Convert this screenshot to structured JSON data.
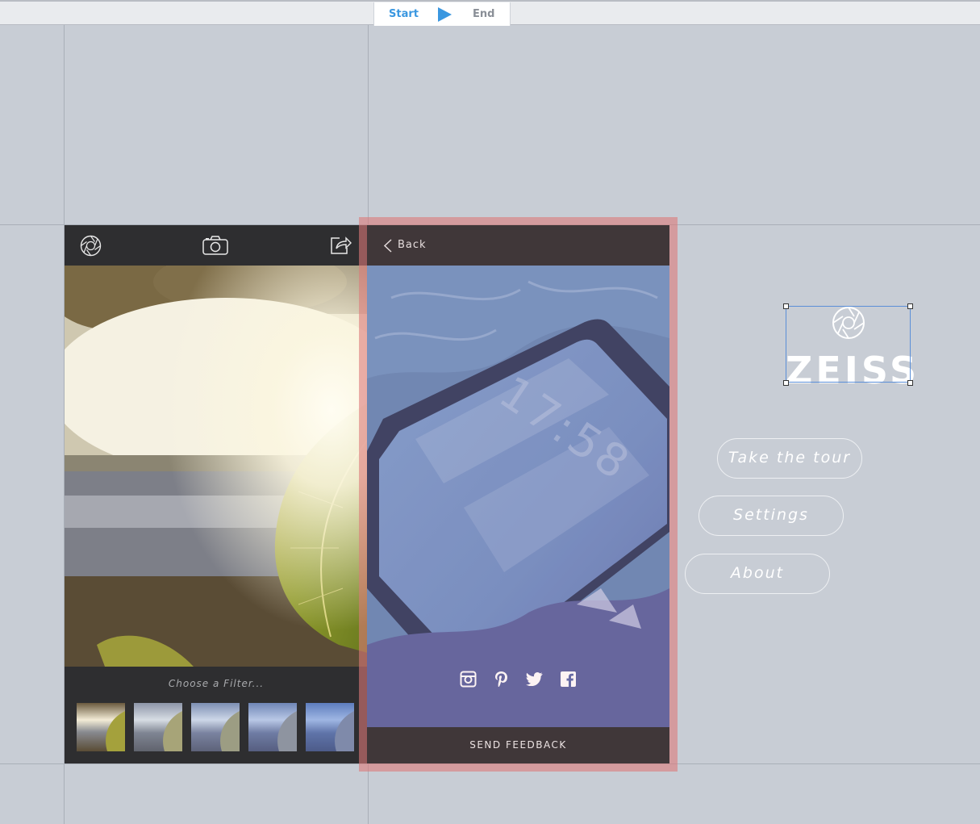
{
  "timeline": {
    "start_label": "Start",
    "end_label": "End",
    "accent_color": "#3a97e0"
  },
  "screen1": {
    "toolbar_icons": [
      "aperture-icon",
      "camera-icon",
      "share-icon"
    ],
    "filter_prompt": "Choose a Filter...",
    "filter_thumbnail_count": 5
  },
  "screen2": {
    "back_label": "Back",
    "social_icons": [
      "instagram-icon",
      "pinterest-icon",
      "twitter-icon",
      "facebook-icon"
    ],
    "feedback_label": "SEND FEEDBACK",
    "lockscreen_time": "17:58"
  },
  "brand": {
    "wordmark": "ZEISS"
  },
  "menu": {
    "tour_label": "Take the tour",
    "settings_label": "Settings",
    "about_label": "About"
  }
}
